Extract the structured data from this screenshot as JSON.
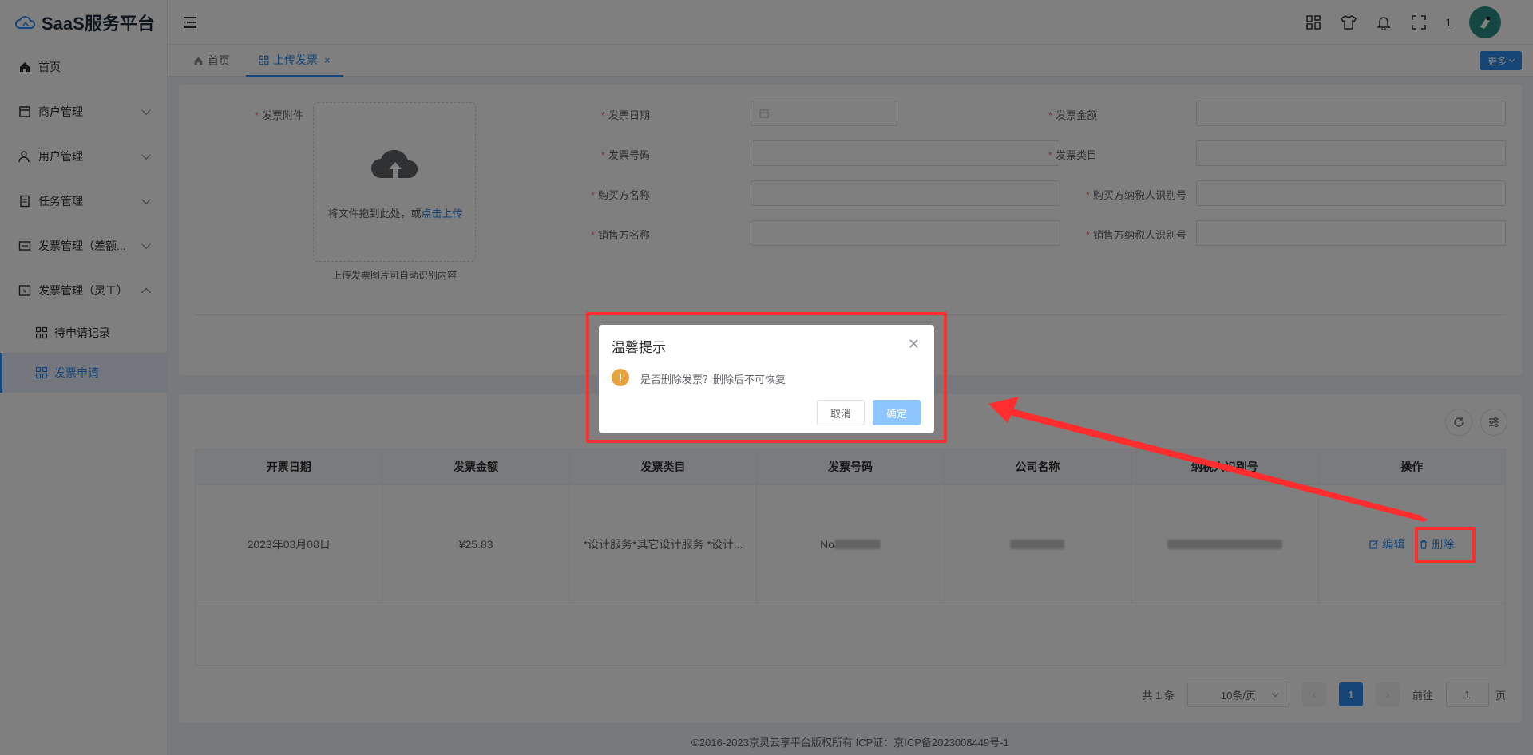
{
  "app": {
    "logo_text": "SaaS服务平台"
  },
  "sidebar": {
    "items": [
      {
        "label": "首页",
        "icon": "home-icon"
      },
      {
        "label": "商户管理",
        "icon": "store-icon"
      },
      {
        "label": "用户管理",
        "icon": "user-icon"
      },
      {
        "label": "任务管理",
        "icon": "task-icon"
      },
      {
        "label": "发票管理（差额...",
        "icon": "invoice-icon"
      },
      {
        "label": "发票管理（灵工）",
        "icon": "invoice-icon"
      }
    ],
    "sub_items": [
      {
        "label": "待申请记录",
        "icon": "grid-icon"
      },
      {
        "label": "发票申请",
        "icon": "grid-icon"
      }
    ]
  },
  "header": {
    "count": "1"
  },
  "tabs": {
    "home": "首页",
    "upload": "上传发票",
    "close": "×",
    "more": "更多"
  },
  "form": {
    "attachment_label": "发票附件",
    "upload_drag_text": "将文件拖到此处，或",
    "upload_link": "点击上传",
    "upload_hint": "上传发票图片可自动识别内容",
    "invoice_date": "发票日期",
    "invoice_amount": "发票金额",
    "invoice_number": "发票号码",
    "invoice_category": "发票类目",
    "buyer_name": "购买方名称",
    "buyer_tax_id": "购买方纳税人识别号",
    "seller_name": "销售方名称",
    "seller_tax_id": "销售方纳税人识别号"
  },
  "table": {
    "headers": [
      "开票日期",
      "发票金额",
      "发票类目",
      "发票号码",
      "公司名称",
      "纳税人识别号",
      "操作"
    ],
    "rows": [
      {
        "date": "2023年03月08日",
        "amount": "¥25.83",
        "category": "*设计服务*其它设计服务 *设计...",
        "number": "No"
      }
    ],
    "edit": "编辑",
    "delete": "删除"
  },
  "pagination": {
    "total": "共 1 条",
    "page_size": "10条/页",
    "current_page": "1",
    "goto_label": "前往",
    "goto_value": "1",
    "page_suffix": "页"
  },
  "footer": {
    "text": "©2016-2023京灵云享平台版权所有 ICP证：京ICP备2023008449号-1"
  },
  "modal": {
    "title": "温馨提示",
    "message": "是否删除发票？删除后不可恢复",
    "cancel": "取消",
    "confirm": "确定"
  },
  "colors": {
    "primary": "#2d8cf0",
    "warning": "#e6a23c",
    "annotation": "#ff2d2d"
  }
}
